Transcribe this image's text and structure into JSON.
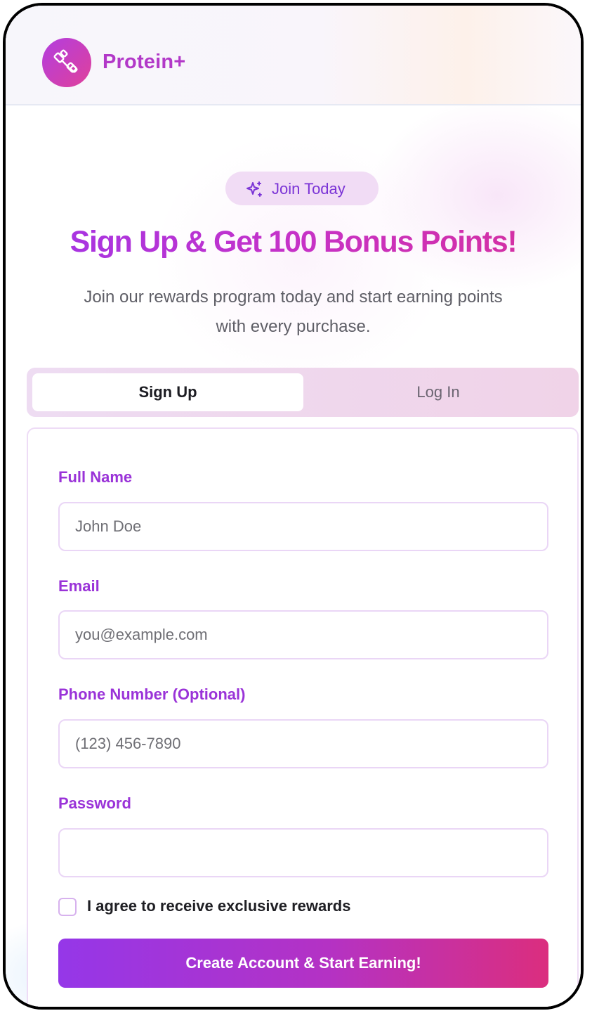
{
  "header": {
    "brand": "Protein+",
    "logo_icon": "dumbbell-icon"
  },
  "hero": {
    "pill_icon": "sparkle-icon",
    "pill_label": "Join Today",
    "headline": "Sign Up & Get 100 Bonus Points!",
    "subtitle_line1": "Join our rewards program today and start earning points",
    "subtitle_line2": "with every purchase."
  },
  "tabs": {
    "signup_label": "Sign Up",
    "login_label": "Log In",
    "active": "Sign Up"
  },
  "form": {
    "full_name_label": "Full Name",
    "full_name_placeholder": "John Doe",
    "email_label": "Email",
    "email_placeholder": "you@example.com",
    "phone_label": "Phone Number (Optional)",
    "phone_placeholder": "(123) 456-7890",
    "password_label": "Password",
    "password_placeholder": "",
    "agree_label": "I agree to receive exclusive rewards",
    "agree_checked": false,
    "submit_label": "Create Account & Start Earning!"
  },
  "colors": {
    "brand_purple": "#b238c8",
    "label_purple": "#9a33d8",
    "button_gradient_start": "#9537e8",
    "button_gradient_end": "#db2e7e"
  }
}
